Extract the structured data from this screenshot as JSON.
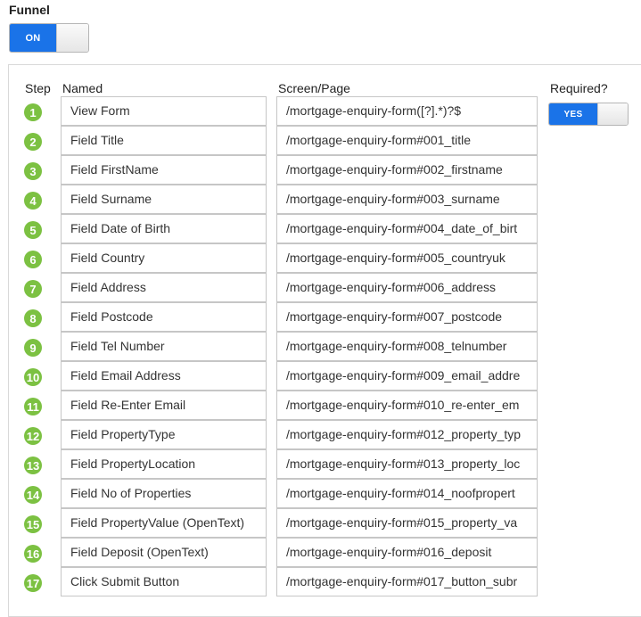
{
  "funnel": {
    "label": "Funnel",
    "toggle_label": "ON"
  },
  "columns": {
    "step": "Step",
    "named": "Named",
    "screen": "Screen/Page",
    "required": "Required?"
  },
  "required_toggle": {
    "label": "YES"
  },
  "colors": {
    "toggle_blue": "#1a73e8",
    "step_badge": "#7cc142"
  },
  "steps": [
    {
      "num": "1",
      "name": "View Form",
      "screen": "/mortgage-enquiry-form([?].*)?$"
    },
    {
      "num": "2",
      "name": "Field Title",
      "screen": "/mortgage-enquiry-form#001_title"
    },
    {
      "num": "3",
      "name": "Field FirstName",
      "screen": "/mortgage-enquiry-form#002_firstname"
    },
    {
      "num": "4",
      "name": "Field Surname",
      "screen": "/mortgage-enquiry-form#003_surname"
    },
    {
      "num": "5",
      "name": "Field Date of Birth",
      "screen": "/mortgage-enquiry-form#004_date_of_birt"
    },
    {
      "num": "6",
      "name": "Field Country",
      "screen": "/mortgage-enquiry-form#005_countryuk"
    },
    {
      "num": "7",
      "name": "Field Address",
      "screen": "/mortgage-enquiry-form#006_address"
    },
    {
      "num": "8",
      "name": "Field Postcode",
      "screen": "/mortgage-enquiry-form#007_postcode"
    },
    {
      "num": "9",
      "name": "Field Tel Number",
      "screen": "/mortgage-enquiry-form#008_telnumber"
    },
    {
      "num": "10",
      "name": "Field Email Address",
      "screen": "/mortgage-enquiry-form#009_email_addre"
    },
    {
      "num": "11",
      "name": "Field Re-Enter Email",
      "screen": "/mortgage-enquiry-form#010_re-enter_em"
    },
    {
      "num": "12",
      "name": "Field PropertyType",
      "screen": "/mortgage-enquiry-form#012_property_typ"
    },
    {
      "num": "13",
      "name": "Field PropertyLocation",
      "screen": "/mortgage-enquiry-form#013_property_loc"
    },
    {
      "num": "14",
      "name": "Field No of Properties",
      "screen": "/mortgage-enquiry-form#014_noofpropert"
    },
    {
      "num": "15",
      "name": "Field PropertyValue (OpenText)",
      "screen": "/mortgage-enquiry-form#015_property_va"
    },
    {
      "num": "16",
      "name": "Field Deposit (OpenText)",
      "screen": "/mortgage-enquiry-form#016_deposit"
    },
    {
      "num": "17",
      "name": "Click Submit Button",
      "screen": "/mortgage-enquiry-form#017_button_subr"
    }
  ]
}
